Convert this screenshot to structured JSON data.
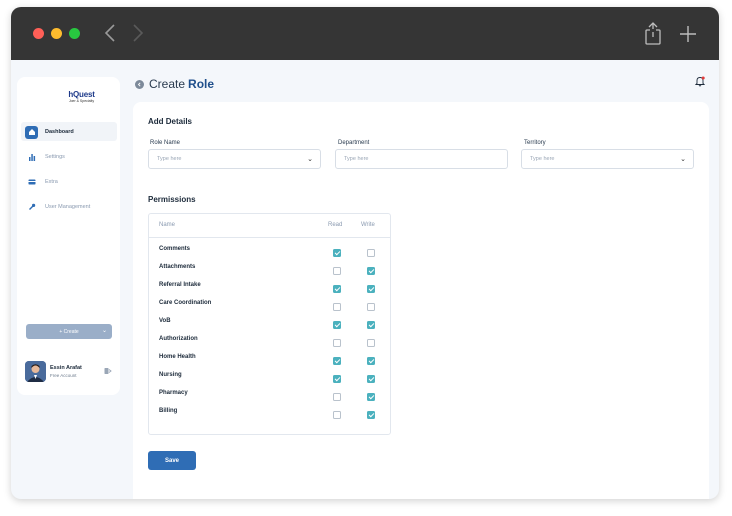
{
  "app": {
    "logo_line1": "hQuest",
    "logo_line2": "Joer & Specialty"
  },
  "sidebar": {
    "items": [
      {
        "label": "Dashboard",
        "icon": "home-icon",
        "active": true
      },
      {
        "label": "Settings",
        "icon": "bar-chart-icon",
        "active": false
      },
      {
        "label": "Extra",
        "icon": "card-icon",
        "active": false
      },
      {
        "label": "User Management",
        "icon": "wrench-icon",
        "active": false
      }
    ],
    "create_label": "+ Create",
    "user_name": "Essin Arafat",
    "user_sub": "Free Account"
  },
  "header": {
    "title_prefix": "Create",
    "title_strong": "Role"
  },
  "details": {
    "section_title": "Add Details",
    "role_name_label": "Role Name",
    "role_name_placeholder": "Type here",
    "department_label": "Department",
    "department_placeholder": "Type here",
    "territory_label": "Territory",
    "territory_placeholder": "Type here"
  },
  "permissions": {
    "section_title": "Permissions",
    "col_name": "Name",
    "col_read": "Read",
    "col_write": "Write",
    "rows": [
      {
        "name": "Comments",
        "read": true,
        "write": false
      },
      {
        "name": "Attachments",
        "read": false,
        "write": true
      },
      {
        "name": "Referral Intake",
        "read": true,
        "write": true
      },
      {
        "name": "Care Coordination",
        "read": false,
        "write": false
      },
      {
        "name": "VoB",
        "read": true,
        "write": true
      },
      {
        "name": "Authorization",
        "read": false,
        "write": false
      },
      {
        "name": "Home Health",
        "read": true,
        "write": true
      },
      {
        "name": "Nursing",
        "read": true,
        "write": true
      },
      {
        "name": "Pharmacy",
        "read": false,
        "write": true
      },
      {
        "name": "Billing",
        "read": false,
        "write": true
      }
    ]
  },
  "actions": {
    "save_label": "Save"
  },
  "colors": {
    "primary": "#2f6db5",
    "checkbox_on": "#4bb1be",
    "titlebar": "#353535"
  }
}
